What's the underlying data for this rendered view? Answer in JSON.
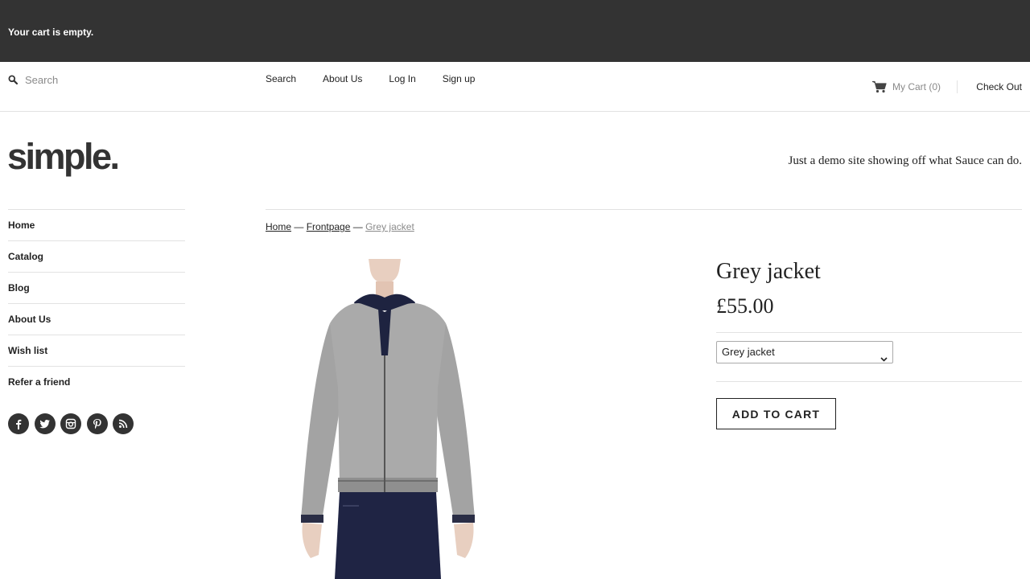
{
  "cart_bar": {
    "message": "Your cart is empty."
  },
  "topnav": {
    "search_placeholder": "Search",
    "links": [
      "Search",
      "About Us",
      "Log In",
      "Sign up"
    ],
    "cart_label": "My Cart (0)",
    "checkout_label": "Check Out"
  },
  "header": {
    "logo_text": "simple.",
    "tagline": "Just a demo site showing off what Sauce can do."
  },
  "sidebar": {
    "items": [
      "Home",
      "Catalog",
      "Blog",
      "About Us",
      "Wish list",
      "Refer a friend"
    ],
    "social_icons": [
      "facebook-icon",
      "twitter-icon",
      "instagram-icon",
      "pinterest-icon",
      "rss-icon"
    ]
  },
  "breadcrumb": {
    "home": "Home",
    "sep": "—",
    "collection": "Frontpage",
    "current": "Grey jacket"
  },
  "product": {
    "title": "Grey jacket",
    "price": "£55.00",
    "variant_selected": "Grey jacket",
    "add_to_cart": "ADD TO CART",
    "image_alt": "Grey jacket"
  },
  "colors": {
    "cart_bar_bg": "#333333",
    "text": "#222222",
    "muted": "#8a8a8a",
    "rule": "#e2e2e2"
  }
}
